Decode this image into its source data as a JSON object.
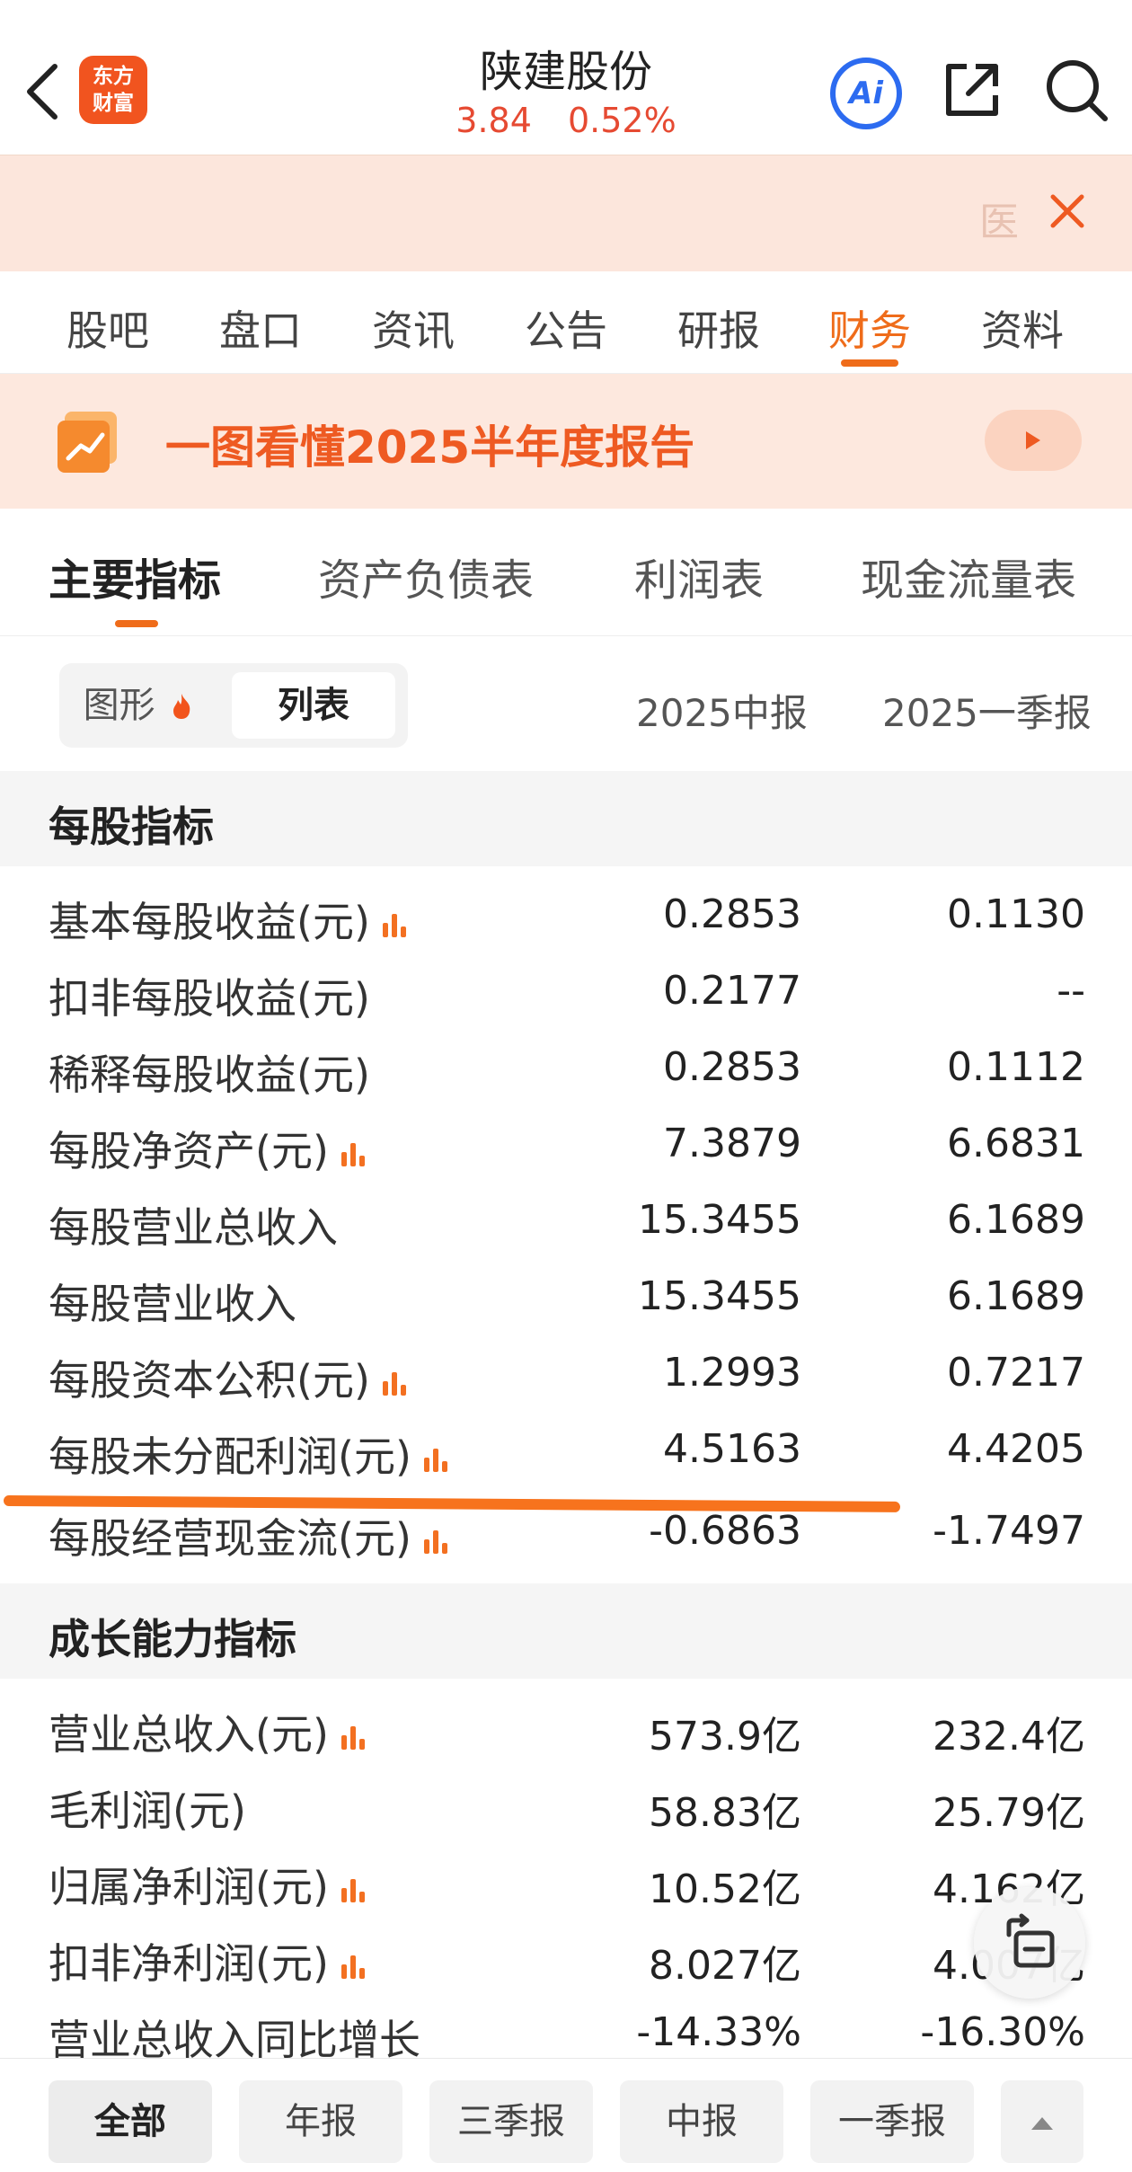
{
  "header": {
    "logo_line1": "东方",
    "logo_line2": "财富",
    "stock_name": "陕建股份",
    "price": "3.84",
    "change": "0.52%",
    "ai_label": "Ai"
  },
  "banner": {
    "partial_char": "医"
  },
  "nav": {
    "items": [
      "股吧",
      "盘口",
      "资讯",
      "公告",
      "研报",
      "财务",
      "资料"
    ],
    "active": "财务"
  },
  "promo": {
    "title": "一图看懂2025半年度报告"
  },
  "subtabs": {
    "items": [
      "主要指标",
      "资产负债表",
      "利润表",
      "现金流量表"
    ],
    "active": "主要指标"
  },
  "toggle": {
    "graph": "图形",
    "list": "列表"
  },
  "columns": {
    "col1": "2025中报",
    "col2": "2025一季报"
  },
  "sections": [
    {
      "title": "每股指标",
      "rows": [
        {
          "label": "基本每股收益(元)",
          "chart": true,
          "v1": "0.2853",
          "v2": "0.1130"
        },
        {
          "label": "扣非每股收益(元)",
          "chart": false,
          "v1": "0.2177",
          "v2": "--"
        },
        {
          "label": "稀释每股收益(元)",
          "chart": false,
          "v1": "0.2853",
          "v2": "0.1112"
        },
        {
          "label": "每股净资产(元)",
          "chart": true,
          "v1": "7.3879",
          "v2": "6.6831"
        },
        {
          "label": "每股营业总收入",
          "chart": false,
          "v1": "15.3455",
          "v2": "6.1689"
        },
        {
          "label": "每股营业收入",
          "chart": false,
          "v1": "15.3455",
          "v2": "6.1689"
        },
        {
          "label": "每股资本公积(元)",
          "chart": true,
          "v1": "1.2993",
          "v2": "0.7217"
        },
        {
          "label": "每股未分配利润(元)",
          "chart": true,
          "v1": "4.5163",
          "v2": "4.4205"
        },
        {
          "label": "每股经营现金流(元)",
          "chart": true,
          "v1": "-0.6863",
          "v2": "-1.7497"
        }
      ]
    },
    {
      "title": "成长能力指标",
      "rows": [
        {
          "label": "营业总收入(元)",
          "chart": true,
          "v1": "573.9亿",
          "v2": "232.4亿"
        },
        {
          "label": "毛利润(元)",
          "chart": false,
          "v1": "58.83亿",
          "v2": "25.79亿"
        },
        {
          "label": "归属净利润(元)",
          "chart": true,
          "v1": "10.52亿",
          "v2": "4.162亿"
        },
        {
          "label": "扣非净利润(元)",
          "chart": true,
          "v1": "8.027亿",
          "v2": "4.007亿"
        },
        {
          "label": "营业总收入同比增长",
          "chart": false,
          "v1": "-14.33%",
          "v2": "-16.30%"
        }
      ]
    }
  ],
  "bottom_filters": {
    "items": [
      "全部",
      "年报",
      "三季报",
      "中报",
      "一季报"
    ],
    "active": "全部"
  },
  "colors": {
    "accent": "#ef6c1a",
    "price_red": "#e64a32",
    "ai_blue": "#2c6bf0",
    "banner_bg": "#fce6dc"
  }
}
